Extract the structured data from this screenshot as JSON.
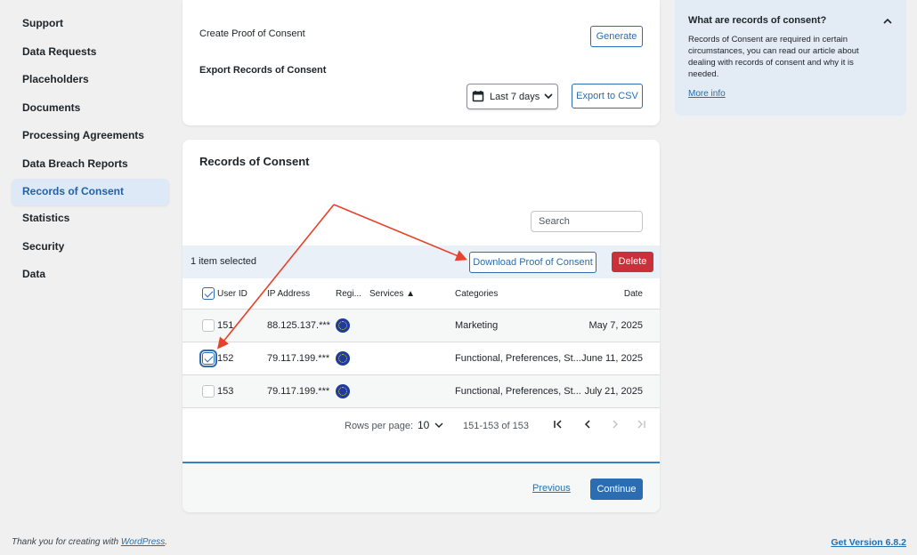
{
  "sidebar": {
    "items": [
      {
        "label": "Support"
      },
      {
        "label": "Data Requests"
      },
      {
        "label": "Placeholders"
      },
      {
        "label": "Documents"
      },
      {
        "label": "Processing Agreements"
      },
      {
        "label": "Data Breach Reports"
      },
      {
        "label": "Records of Consent",
        "active": true
      },
      {
        "label": "Statistics"
      },
      {
        "label": "Security"
      },
      {
        "label": "Data"
      }
    ]
  },
  "export_card": {
    "proof_label": "Create Proof of Consent",
    "generate_button": "Generate",
    "export_heading": "Export Records of Consent",
    "range_select": "Last 7 days",
    "export_button": "Export to CSV"
  },
  "records": {
    "title": "Records of Consent",
    "search_placeholder": "Search",
    "selection_text": "1 item selected",
    "download_button": "Download Proof of Consent",
    "delete_button": "Delete",
    "columns": {
      "user_id": "User ID",
      "ip": "IP Address",
      "region": "Regi...",
      "services": "Services ▲",
      "categories": "Categories",
      "date": "Date"
    },
    "rows": [
      {
        "user_id": "151",
        "ip": "88.125.137.***",
        "categories": "Marketing",
        "date": "May 7, 2025",
        "checked": false
      },
      {
        "user_id": "152",
        "ip": "79.117.199.***",
        "categories": "Functional, Preferences, St...",
        "date": "June 11, 2025",
        "checked": true
      },
      {
        "user_id": "153",
        "ip": "79.117.199.***",
        "categories": "Functional, Preferences, St...",
        "date": "July 21, 2025",
        "checked": false
      }
    ],
    "pagination": {
      "rows_per_page_label": "Rows per page:",
      "rows_per_page": "10",
      "range": "151-153 of 153"
    },
    "previous_link": "Previous",
    "continue_button": "Continue"
  },
  "help": {
    "title": "What are records of consent?",
    "body": "Records of Consent are required in certain circumstances, you can read our article about dealing with records of consent and why it is needed.",
    "link": "More info"
  },
  "footer": {
    "thanks_prefix": "Thank you for creating with ",
    "wordpress_link": "WordPress",
    "thanks_suffix": ".",
    "version_link": "Get Version 6.8.2"
  },
  "colors": {
    "accent": "#2c6cb0",
    "danger": "#c8303a",
    "annotation_arrow": "#e5432b"
  }
}
